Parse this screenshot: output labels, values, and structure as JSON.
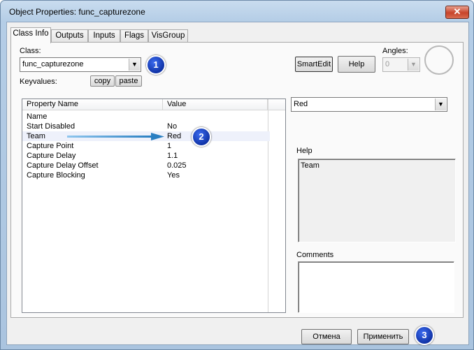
{
  "window": {
    "title": "Object Properties: func_capturezone",
    "close_glyph": "✕"
  },
  "tabs": [
    {
      "label": "Class Info",
      "active": true
    },
    {
      "label": "Outputs"
    },
    {
      "label": "Inputs"
    },
    {
      "label": "Flags"
    },
    {
      "label": "VisGroup"
    }
  ],
  "class_section": {
    "label": "Class:",
    "value": "func_capturezone",
    "keyvalues_label": "Keyvalues:",
    "copy_label": "copy",
    "paste_label": "paste"
  },
  "toolbar": {
    "smartedit_label": "SmartEdit",
    "help_label": "Help",
    "angles_label": "Angles:",
    "angles_value": "0"
  },
  "property_table": {
    "columns": [
      "Property Name",
      "Value"
    ],
    "rows": [
      {
        "name": "Name",
        "value": ""
      },
      {
        "name": "Start Disabled",
        "value": "No"
      },
      {
        "name": "Team",
        "value": "Red"
      },
      {
        "name": "Capture Point",
        "value": "1"
      },
      {
        "name": "Capture Delay",
        "value": "1.1"
      },
      {
        "name": "Capture Delay Offset",
        "value": "0.025"
      },
      {
        "name": "Capture Blocking",
        "value": "Yes"
      }
    ]
  },
  "value_editor": {
    "value": "Red"
  },
  "help_box": {
    "label": "Help",
    "text": "Team"
  },
  "comments_box": {
    "label": "Comments",
    "text": ""
  },
  "footer": {
    "cancel_label": "Отмена",
    "apply_label": "Применить"
  },
  "annotations": {
    "badge1": "1",
    "badge2": "2",
    "badge3": "3"
  },
  "colors": {
    "badge": "#1b3fb8",
    "arrow": "#2a7fc2",
    "selected_row": "#eef1fb"
  }
}
